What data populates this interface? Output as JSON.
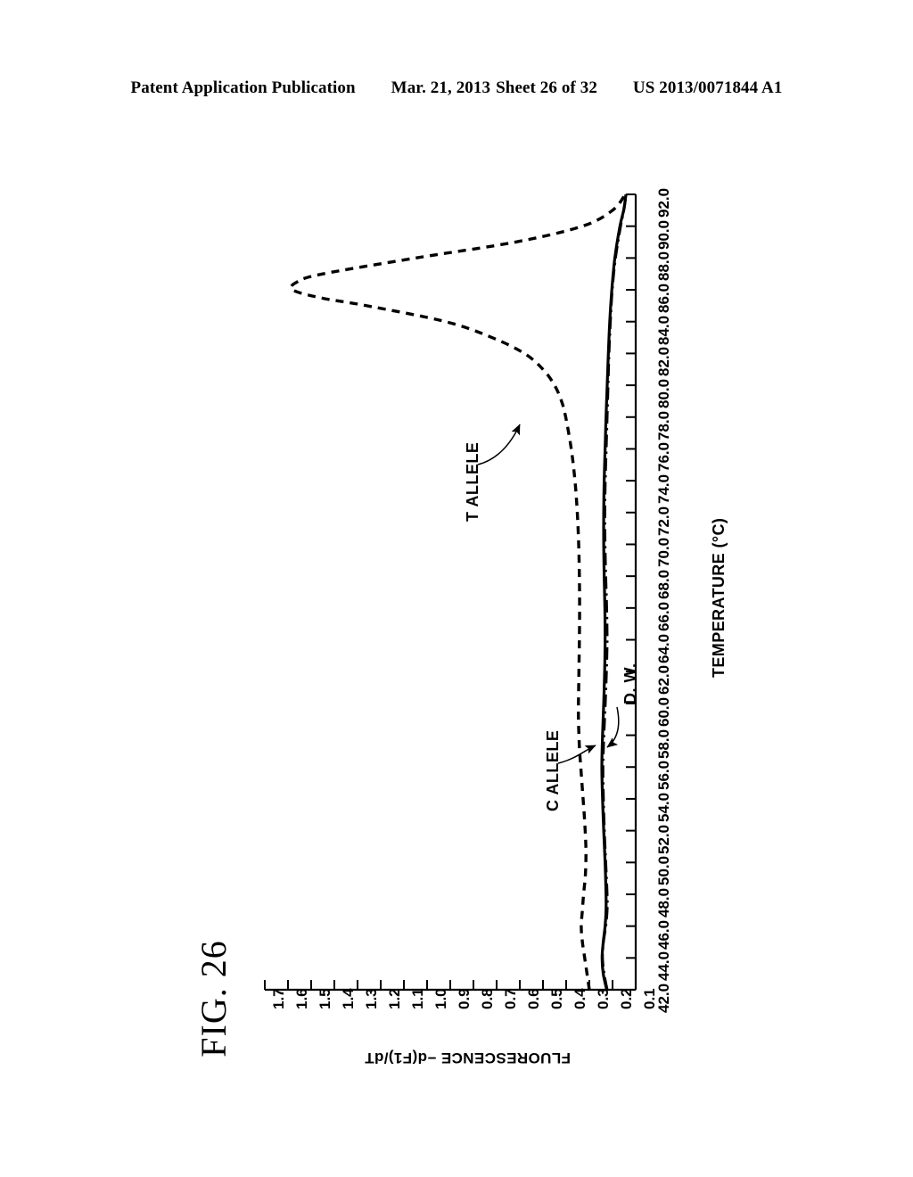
{
  "header": {
    "publication": "Patent Application Publication",
    "date": "Mar. 21, 2013",
    "sheet": "Sheet 26 of 32",
    "doc_number": "US 2013/0071844 A1"
  },
  "figure": {
    "label": "FIG. 26"
  },
  "chart_data": {
    "type": "line",
    "title": "FIG. 26",
    "orientation": "rotated-90",
    "xlabel": "TEMPERATURE (°C)",
    "ylabel": "FLUORESCENCE  −d(F1)/dT",
    "xlim": [
      42.0,
      92.0
    ],
    "ylim": [
      0.1,
      1.7
    ],
    "grid": false,
    "legend": "inline-annotations",
    "x_ticks": [
      "42.0",
      "44.0",
      "46.0",
      "48.0",
      "50.0",
      "52.0",
      "54.0",
      "56.0",
      "58.0",
      "60.0",
      "62.0",
      "64.0",
      "66.0",
      "68.0",
      "70.0",
      "72.0",
      "74.0",
      "76.0",
      "78.0",
      "80.0",
      "82.0",
      "84.0",
      "86.0",
      "88.0",
      "90.0",
      "92.0"
    ],
    "y_ticks": [
      "1.7",
      "1.6",
      "1.5",
      "1.4",
      "1.3",
      "1.2",
      "1.1",
      "1.0",
      "0.9",
      "0.8",
      "0.7",
      "0.6",
      "0.5",
      "0.4",
      "0.3",
      "0.2",
      "0.1"
    ],
    "annotations": [
      {
        "text": "T ALLELE",
        "points_to": "t-allele-curve"
      },
      {
        "text": "C ALLELE",
        "points_to": "c-allele-curve"
      },
      {
        "text": "D. W.",
        "points_to": "dw-curve"
      }
    ],
    "series": [
      {
        "name": "T ALLELE",
        "style": "dashed",
        "x": [
          42.0,
          44.0,
          45.0,
          46.0,
          47.0,
          48.0,
          49.0,
          50.0,
          51.0,
          52.0,
          53.0,
          54.0,
          55.0,
          56.0,
          57.0,
          58.0,
          59.0,
          60.0,
          62.0,
          64.0,
          66.0,
          68.0,
          70.0,
          72.0,
          74.0,
          76.0,
          78.0,
          79.0,
          80.0,
          81.0,
          82.0,
          83.0,
          84.0,
          85.0,
          85.5,
          86.0,
          86.5,
          87.0,
          88.0,
          89.0,
          90.0,
          91.0,
          92.0
        ],
        "y": [
          0.3,
          0.32,
          0.33,
          0.335,
          0.33,
          0.325,
          0.318,
          0.315,
          0.315,
          0.318,
          0.322,
          0.327,
          0.332,
          0.337,
          0.342,
          0.345,
          0.347,
          0.347,
          0.345,
          0.343,
          0.342,
          0.343,
          0.346,
          0.352,
          0.362,
          0.378,
          0.402,
          0.42,
          0.45,
          0.5,
          0.58,
          0.72,
          0.92,
          1.26,
          1.46,
          1.58,
          1.56,
          1.45,
          1.05,
          0.62,
          0.33,
          0.2,
          0.145
        ]
      },
      {
        "name": "C ALLELE",
        "style": "solid",
        "x": [
          42.0,
          43.0,
          44.0,
          45.0,
          46.0,
          47.0,
          48.0,
          50.0,
          52.0,
          54.0,
          56.0,
          58.0,
          60.0,
          62.0,
          64.0,
          66.0,
          68.0,
          70.0,
          72.0,
          74.0,
          76.0,
          78.0,
          80.0,
          82.0,
          84.0,
          86.0,
          88.0,
          90.0,
          91.0,
          92.0
        ],
        "y": [
          0.225,
          0.24,
          0.245,
          0.24,
          0.232,
          0.228,
          0.228,
          0.232,
          0.238,
          0.243,
          0.246,
          0.243,
          0.238,
          0.234,
          0.232,
          0.233,
          0.236,
          0.238,
          0.238,
          0.236,
          0.232,
          0.228,
          0.223,
          0.218,
          0.212,
          0.203,
          0.19,
          0.168,
          0.152,
          0.142
        ]
      },
      {
        "name": "D. W.",
        "style": "dash-dot",
        "x": [
          42.0,
          43.0,
          44.0,
          45.0,
          46.0,
          47.0,
          48.0,
          50.0,
          52.0,
          54.0,
          56.0,
          58.0,
          60.0,
          62.0,
          64.0,
          66.0,
          68.0,
          70.0,
          72.0,
          74.0,
          76.0,
          78.0,
          80.0,
          82.0,
          84.0,
          86.0,
          88.0,
          90.0,
          91.0,
          92.0
        ],
        "y": [
          0.222,
          0.235,
          0.242,
          0.238,
          0.228,
          0.222,
          0.222,
          0.228,
          0.234,
          0.238,
          0.24,
          0.236,
          0.23,
          0.225,
          0.222,
          0.224,
          0.228,
          0.231,
          0.232,
          0.23,
          0.226,
          0.222,
          0.218,
          0.214,
          0.208,
          0.2,
          0.186,
          0.164,
          0.15,
          0.14
        ]
      }
    ]
  }
}
